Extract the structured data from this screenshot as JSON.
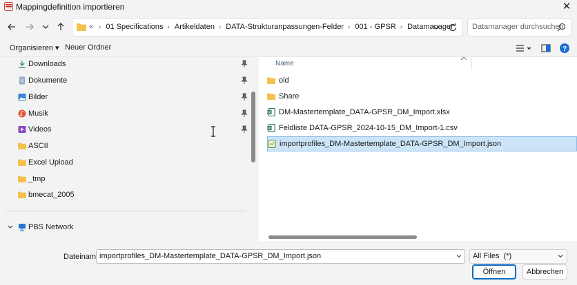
{
  "window": {
    "title": "Mappingdefinition importieren"
  },
  "address": {
    "overflow": "«",
    "crumbs": [
      "01 Specifications",
      "Artikeldaten",
      "DATA-Strukturanpassungen-Felder",
      "001 - GPSR",
      "Datamanager"
    ],
    "separator": "›"
  },
  "search": {
    "placeholder": "Datamanager durchsuchen"
  },
  "toolbar": {
    "organize": "Organisieren ▾",
    "new_folder": "Neuer Ordner"
  },
  "sidebar": {
    "items": [
      {
        "label": "Downloads",
        "icon": "download-icon",
        "pinned": true
      },
      {
        "label": "Dokumente",
        "icon": "document-icon",
        "pinned": true
      },
      {
        "label": "Bilder",
        "icon": "picture-icon",
        "pinned": true
      },
      {
        "label": "Musik",
        "icon": "music-icon",
        "pinned": true
      },
      {
        "label": "Videos",
        "icon": "video-icon",
        "pinned": true
      },
      {
        "label": "ASCII",
        "icon": "folder-icon",
        "pinned": false
      },
      {
        "label": "Excel Upload",
        "icon": "folder-icon",
        "pinned": false
      },
      {
        "label": "_tmp",
        "icon": "folder-icon",
        "pinned": false
      },
      {
        "label": "bmecat_2005",
        "icon": "folder-icon",
        "pinned": false
      }
    ],
    "network": {
      "label": "PBS Network",
      "icon": "network-icon"
    }
  },
  "files": {
    "column_name": "Name",
    "rows": [
      {
        "name": "old",
        "icon": "folder-icon",
        "selected": false
      },
      {
        "name": "Share",
        "icon": "folder-icon",
        "selected": false
      },
      {
        "name": "DM-Mastertemplate_DATA-GPSR_DM_Import.xlsx",
        "icon": "excel-icon",
        "selected": false
      },
      {
        "name": "Feldliste DATA-GPSR_2024-10-15_DM_Import-1.csv",
        "icon": "excel-icon",
        "selected": false
      },
      {
        "name": "importprofiles_DM-Mastertemplate_DATA-GPSR_DM_Import.json",
        "icon": "json-file-icon",
        "selected": true
      }
    ]
  },
  "footer": {
    "filename_label": "Dateiname:",
    "filename_value": "importprofiles_DM-Mastertemplate_DATA-GPSR_DM_Import.json",
    "filetype_value": "All Files  (*)",
    "open_label": "Öffnen",
    "cancel_label": "Abbrechen"
  },
  "colors": {
    "accent": "#0067c0",
    "selection": "#cce4f7",
    "folder": "#f2c14e"
  }
}
